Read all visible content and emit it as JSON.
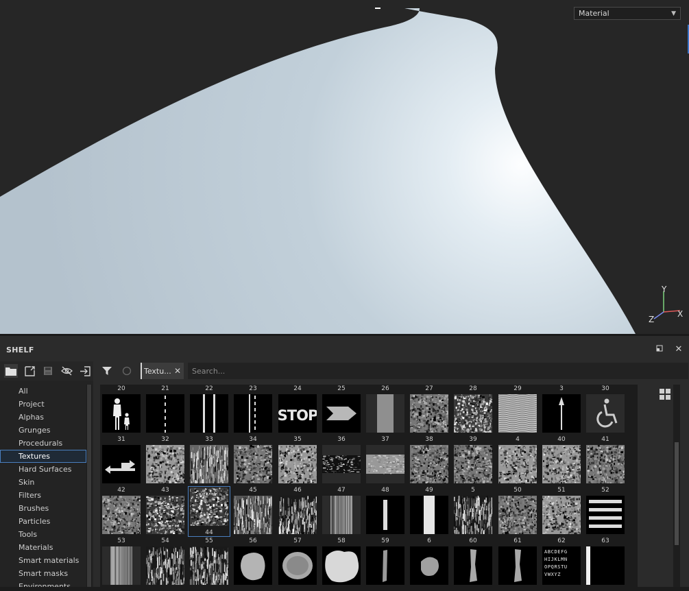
{
  "viewport": {
    "mode_select": "Material"
  },
  "gizmo": {
    "y": "Y",
    "x": "X",
    "z": "Z"
  },
  "shelf": {
    "title": "SHELF",
    "categories": [
      {
        "label": "All"
      },
      {
        "label": "Project"
      },
      {
        "label": "Alphas"
      },
      {
        "label": "Grunges"
      },
      {
        "label": "Procedurals"
      },
      {
        "label": "Textures",
        "selected": true
      },
      {
        "label": "Hard Surfaces"
      },
      {
        "label": "Skin"
      },
      {
        "label": "Filters"
      },
      {
        "label": "Brushes"
      },
      {
        "label": "Particles"
      },
      {
        "label": "Tools"
      },
      {
        "label": "Materials"
      },
      {
        "label": "Smart materials"
      },
      {
        "label": "Smart masks"
      },
      {
        "label": "Environments"
      }
    ],
    "filter_chip": "Textu...",
    "search_placeholder": "Search...",
    "rows": [
      [
        "20",
        "21",
        "22",
        "23",
        "24",
        "25",
        "26",
        "27",
        "28",
        "29",
        "3",
        "30"
      ],
      [
        "31",
        "32",
        "33",
        "34",
        "35",
        "36",
        "37",
        "38",
        "39",
        "4",
        "40",
        "41"
      ],
      [
        "42",
        "43",
        "44",
        "45",
        "46",
        "47",
        "48",
        "49",
        "5",
        "50",
        "51",
        "52"
      ],
      [
        "53",
        "54",
        "55",
        "56",
        "57",
        "58",
        "59",
        "6",
        "60",
        "61",
        "62",
        "63"
      ]
    ],
    "selected_item": "44",
    "stop_text": "STOP",
    "letters_text": "ABCDEFGHIJKLMNOPQRSTUVWXYZ",
    "colors": {
      "accent": "#4a7fbf",
      "panel": "#2b2b2b",
      "viewport": "#262626"
    }
  }
}
